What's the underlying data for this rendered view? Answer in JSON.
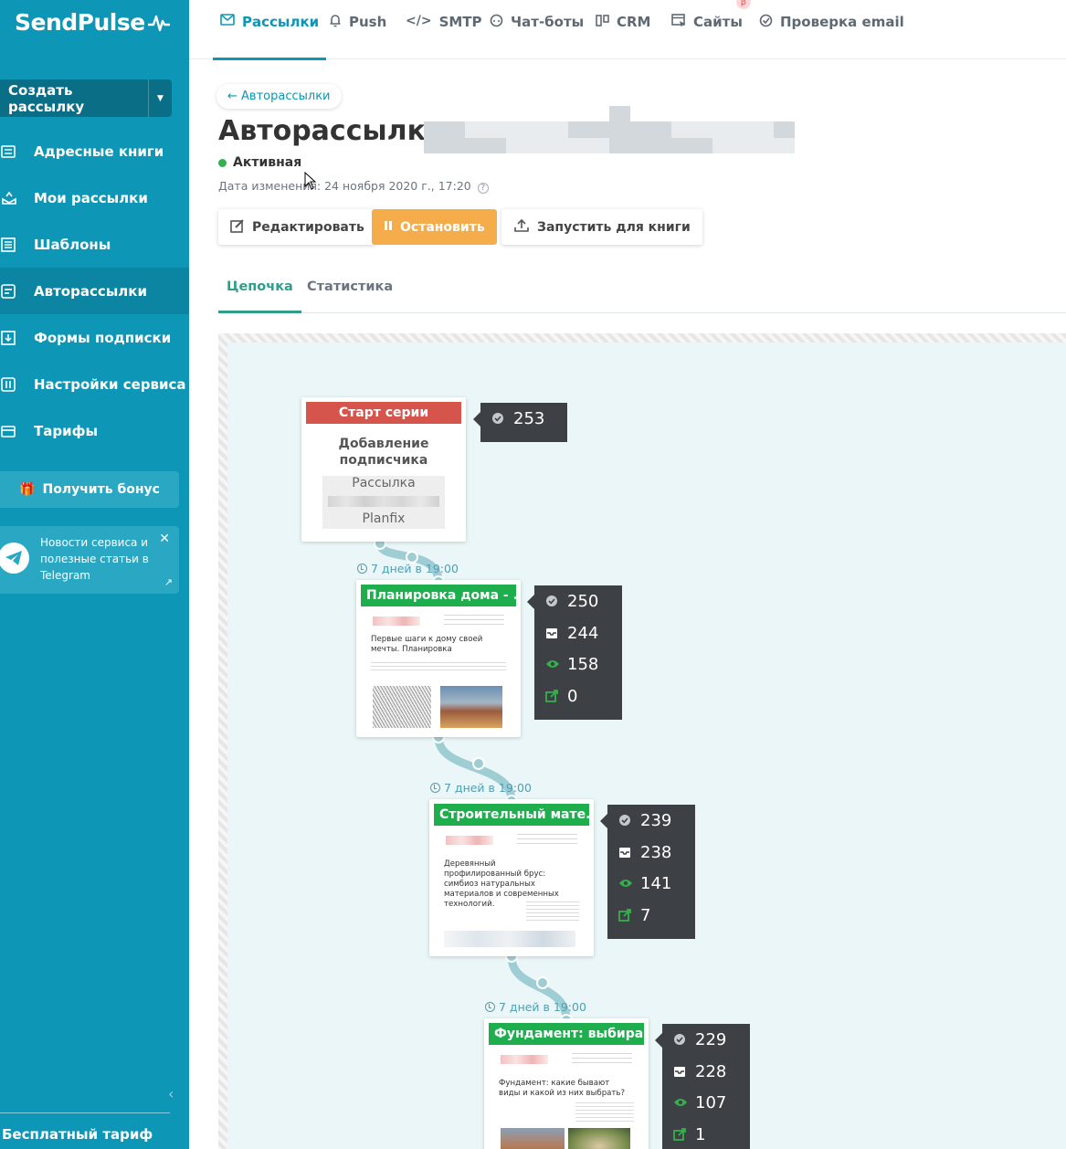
{
  "brand": {
    "logo": "SendPulse"
  },
  "sidebar": {
    "create_button": "Создать рассылку",
    "items": [
      {
        "label": "Адресные книги",
        "icon": "address-book-icon"
      },
      {
        "label": "Мои рассылки",
        "icon": "campaigns-icon"
      },
      {
        "label": "Шаблоны",
        "icon": "templates-icon"
      },
      {
        "label": "Авторассылки",
        "icon": "automation-icon",
        "active": true
      },
      {
        "label": "Формы подписки",
        "icon": "forms-icon"
      },
      {
        "label": "Настройки сервиса",
        "icon": "settings-icon"
      },
      {
        "label": "Тарифы",
        "icon": "pricing-icon"
      }
    ],
    "bonus": "Получить бонус",
    "telegram_text": "Новости сервиса и полезные статьи в Telegram",
    "plan": "Бесплатный тариф"
  },
  "topnav": {
    "items": [
      {
        "label": "Рассылки",
        "active": true
      },
      {
        "label": "Push"
      },
      {
        "label": "SMTP"
      },
      {
        "label": "Чат-боты"
      },
      {
        "label": "CRM"
      },
      {
        "label": "Сайты",
        "badge": "β"
      },
      {
        "label": "Проверка email"
      }
    ]
  },
  "page": {
    "back": "← Авторассылки",
    "title": "Авторассылка",
    "status": "Активная",
    "modified": "Дата изменения: 24 ноября 2020 г., 17:20",
    "buttons": {
      "edit": "Редактировать",
      "stop": "Остановить",
      "run": "Запустить для книги"
    },
    "tabs": [
      {
        "label": "Цепочка",
        "active": true
      },
      {
        "label": "Статистика"
      }
    ]
  },
  "flow": {
    "start": {
      "header": "Старт серии",
      "trigger": "Добавление подписчика",
      "book_line1": "Рассылка",
      "book_line3": "Planfix",
      "sent": "253"
    },
    "steps": [
      {
        "delay": "7 дней в 19:00",
        "header": "Планировка дома - ...",
        "preview_title": "Первые шаги к дому своей мечты. Планировка",
        "sent": "250",
        "delivered": "244",
        "opened": "158",
        "clicked": "0"
      },
      {
        "delay": "7 дней в 19:00",
        "header": "Строительный мате...",
        "preview_title": "Деревянный профилированный брус: симбиоз натуральных материалов и современных технологий.",
        "sent": "239",
        "delivered": "238",
        "opened": "141",
        "clicked": "7"
      },
      {
        "delay": "7 дней в 19:00",
        "header": "Фундамент: выбира...",
        "preview_title": "Фундамент: какие бывают виды и какой из них выбрать?",
        "sent": "229",
        "delivered": "228",
        "opened": "107",
        "clicked": "1"
      }
    ]
  },
  "colors": {
    "sidebar": "#0d96b5",
    "accent": "#0d96b5",
    "active_status": "#33b14d",
    "stop_button": "#f5ad4b",
    "start_header": "#d5554c",
    "step_header": "#1fae4e",
    "stats_panel": "#3d4146"
  }
}
